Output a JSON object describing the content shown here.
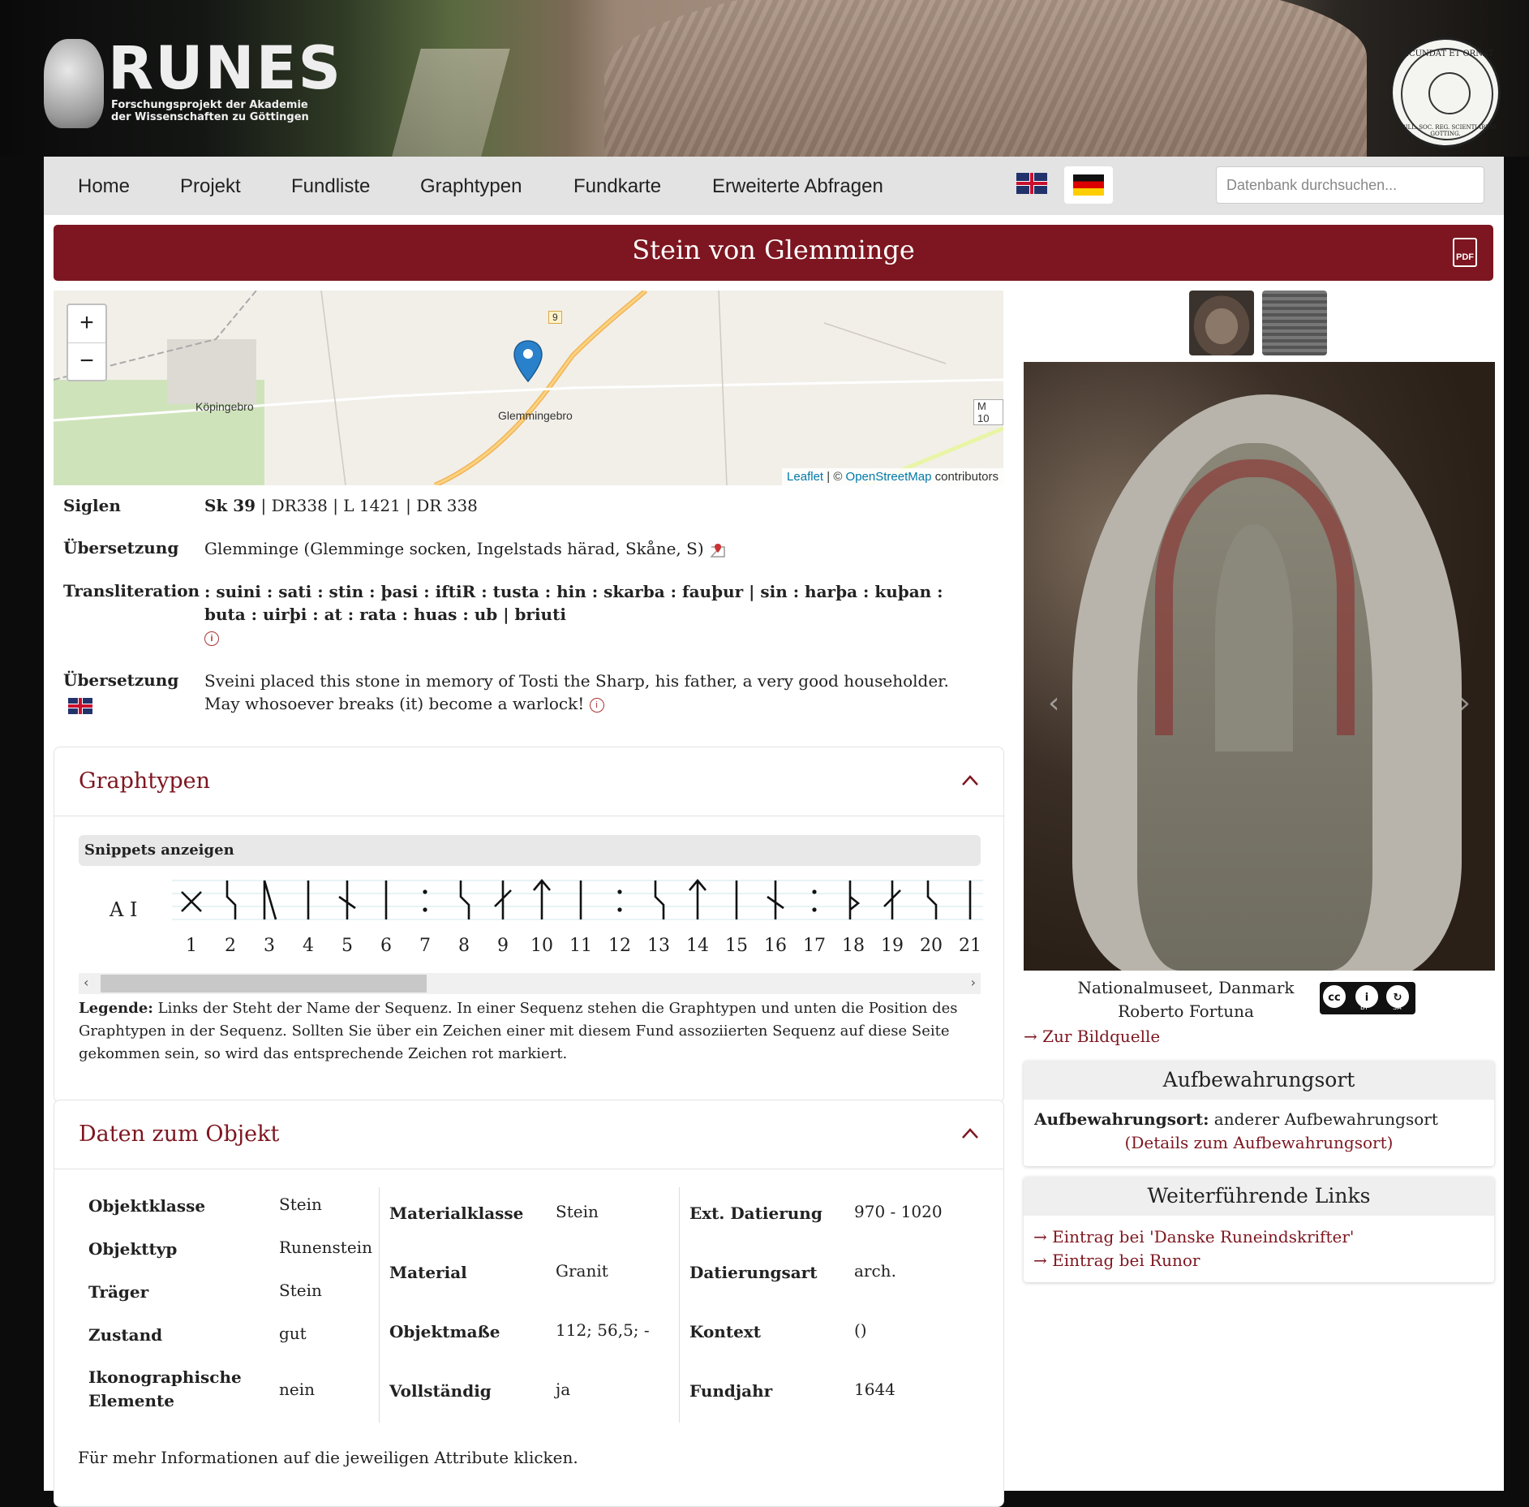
{
  "header": {
    "logo_title": "RUNES",
    "logo_sub_1": "Forschungsprojekt der Akademie",
    "logo_sub_2": "der Wissenschaften zu Göttingen",
    "seal_top": "FECUNDAT ET ORNAT",
    "seal_bottom": "SIGILL. SOC. REG. SCIENTIARUM GOTTING."
  },
  "nav": {
    "items": [
      "Home",
      "Projekt",
      "Fundliste",
      "Graphtypen",
      "Fundkarte",
      "Erweiterte Abfragen"
    ],
    "search_placeholder": "Datenbank durchsuchen..."
  },
  "title": "Stein von Glemminge",
  "pdf_label": "PDF",
  "map": {
    "zoom_in": "+",
    "zoom_out": "−",
    "labels": {
      "koepingebro": "Köpingebro",
      "glemmingebro": "Glemmingebro",
      "road9": "9",
      "m10": "M 10"
    },
    "attribution_leaflet": "Leaflet",
    "attribution_sep": " | © ",
    "attribution_osm": "OpenStreetMap",
    "attribution_tail": " contributors"
  },
  "info": {
    "siglen_label": "Siglen",
    "siglen_main": "Sk 39",
    "siglen_rest": " | DR338 | L 1421 | DR 338",
    "location_label": "Übersetzung",
    "location_value": "Glemminge (Glemminge socken, Ingelstads härad, Skåne, S)",
    "translit_label": "Transliteration",
    "translit_value": ": suini : sati : stin : þasi : iftiR : tusta : hin : skarba : fauþur | sin : harþa : kuþan : buta : uirþi : at : rata : huas : ub | briuti",
    "translation_label": "Übersetzung",
    "translation_value": "Sveini placed this stone in memory of Tosti the Sharp, his father, a very good householder. May whosoever breaks (it) become a warlock!",
    "info_glyph": "i"
  },
  "graphtypen": {
    "title": "Graphtypen",
    "snippets_label": "Snippets anzeigen",
    "sequence_name": "A I",
    "positions": [
      "1",
      "2",
      "3",
      "4",
      "5",
      "6",
      "7",
      "8",
      "9",
      "10",
      "11",
      "12",
      "13",
      "14",
      "15",
      "16",
      "17",
      "18",
      "19",
      "20",
      "21"
    ],
    "rune_icons": [
      "gebo-rune",
      "sowilo-rune",
      "long-branch-rune",
      "isa-rune",
      "nauthiz-rune",
      "isa-rune",
      "separator-dots",
      "sowilo-rune",
      "ar-rune",
      "tiwaz-rune",
      "isa-rune",
      "separator-dots",
      "sowilo-rune",
      "tiwaz-rune",
      "isa-rune",
      "nauthiz-rune",
      "separator-dots",
      "thurisaz-rune",
      "ar-rune",
      "sowilo-rune",
      "isa-rune"
    ],
    "legend_label": "Legende:",
    "legend_text": " Links der Steht der Name der Sequenz. In einer Sequenz stehen die Graphtypen und unten die Position des Graphtypen in der Sequenz. Sollten Sie über ein Zeichen einer mit diesem Fund assoziierten Sequenz auf diese Seite gekommen sein, so wird das entsprechende Zeichen rot markiert."
  },
  "objekt": {
    "title": "Daten zum Objekt",
    "col1": [
      {
        "label": "Objektklasse",
        "value": "Stein"
      },
      {
        "label": "Objekttyp",
        "value": "Runenstein"
      },
      {
        "label": "Träger",
        "value": "Stein"
      },
      {
        "label": "Zustand",
        "value": "gut"
      },
      {
        "label": "Ikonographische Elemente",
        "value": "nein"
      }
    ],
    "col2": [
      {
        "label": "Materialklasse",
        "value": "Stein"
      },
      {
        "label": "Material",
        "value": "Granit"
      },
      {
        "label": "Objektmaße",
        "value": "112; 56,5; -"
      },
      {
        "label": "Vollständig",
        "value": "ja"
      }
    ],
    "col3": [
      {
        "label": "Ext. Datierung",
        "value": "970 - 1020"
      },
      {
        "label": "Datierungsart",
        "value": "arch."
      },
      {
        "label": "Kontext",
        "value": "()"
      },
      {
        "label": "Fundjahr",
        "value": "1644"
      }
    ],
    "footer_note": "Für mehr Informationen auf die jeweiligen Attribute klicken."
  },
  "image": {
    "credit_1": "Nationalmuseet, Danmark",
    "credit_2": "Roberto Fortuna",
    "cc_by": "BY",
    "cc_sa": "SA",
    "source_link": "→ Zur Bildquelle",
    "prev": "‹",
    "next": "›"
  },
  "aufbewahrung": {
    "title": "Aufbewahrungsort",
    "label": "Aufbewahrungsort:",
    "value": " anderer Aufbewahrungsort",
    "details_link": "(Details zum Aufbewahrungsort)"
  },
  "links": {
    "title": "Weiterführende Links",
    "items": [
      "→ Eintrag bei 'Danske Runeindskrifter'",
      "→ Eintrag bei Runor"
    ]
  },
  "colors": {
    "accent": "#7d1620",
    "nav_bg": "#e3e3e3"
  }
}
